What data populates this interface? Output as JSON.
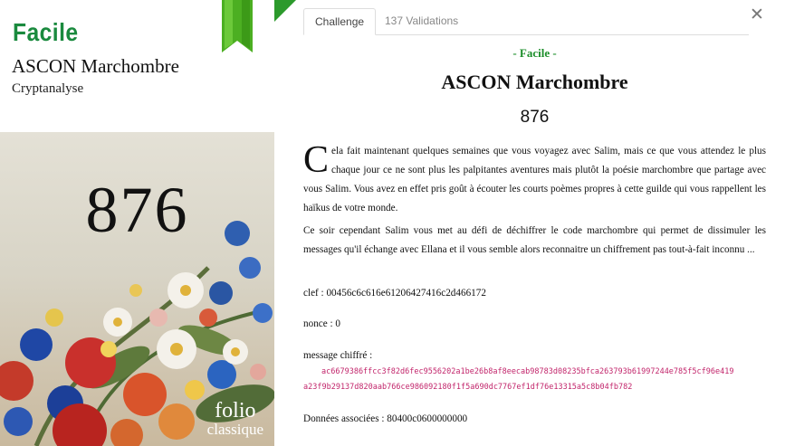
{
  "card": {
    "difficulty": "Facile",
    "title": "ASCON Marchombre",
    "category": "Cryptanalyse",
    "cover": {
      "number": "876",
      "brand_line1": "folio",
      "brand_line2": "classique"
    }
  },
  "tabs": [
    {
      "label": "Challenge",
      "active": true
    },
    {
      "label": "137 Validations",
      "active": false
    }
  ],
  "challenge": {
    "level": "- Facile -",
    "title": "ASCON Marchombre",
    "score": "876",
    "intro_dropcap": "C",
    "intro_rest": "ela fait maintenant quelques semaines que vous voyagez avec Salim, mais ce que vous attendez le plus chaque jour ce ne sont plus les palpitantes aventures mais plutôt la poésie marchombre que partage avec vous Salim. Vous avez en effet pris goût à écouter les courts poèmes propres à cette guilde qui vous rappellent les haïkus de votre monde.",
    "paragraph2": "Ce soir cependant Salim vous met au défi de déchiffrer le code marchombre qui permet de dissimuler les messages qu'il échange avec Ellana et il vous semble alors reconnaitre un chiffrement pas tout-à-fait inconnu ...",
    "key_line": "clef : 00456c6c616e61206427416c2d466172",
    "nonce_line": "nonce : 0",
    "message_label": "message chiffré :",
    "ciphertext_line1": "ac6679386ffcc3f82d6fec9556202a1be26b8af8eecab98783d08235bfca263793b61997244e785f5cf96e419",
    "ciphertext_line2": "a23f9b29137d820aab766ce986092180f1f5a690dc7767ef1df76e13315a5c8b04fb782",
    "assoc_line": "Données associées : 80400c0600000000"
  },
  "colors": {
    "difficulty_green": "#1a8a3e",
    "level_green": "#1e8f2c",
    "ribbon_green": "#4caf22",
    "ciphertext": "#c2256b"
  },
  "icons": {
    "close": "close-icon",
    "ribbon": "bookmark-ribbon-icon"
  }
}
